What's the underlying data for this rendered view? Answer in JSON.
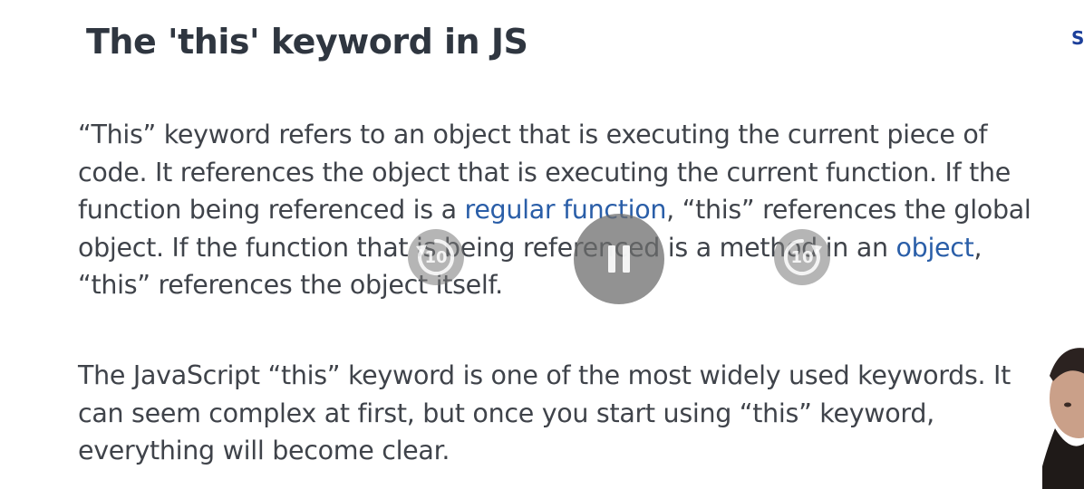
{
  "slide": {
    "title": "The 'this' keyword in JS",
    "corner_link": "S",
    "paragraph1": {
      "line1": "“This” keyword refers to an object that is executing the current piece of",
      "line2": "code. It references the object that is executing the current function. If the",
      "line3_before": "function being referenced is a ",
      "line3_link": "regular function",
      "line3_after": ", “this” references the global",
      "line4_before": "object. If the function that is being referenced is a method in an ",
      "line4_link": "object",
      "line4_after": ",",
      "line5": "“this” references the object itself."
    },
    "paragraph2": {
      "line1": "The JavaScript “this” keyword is one of the most widely used keywords. It",
      "line2": "can seem complex at first, but once you start using “this” keyword,",
      "line3": "everything will become clear."
    }
  },
  "player": {
    "rewind_seconds": "10",
    "forward_seconds": "10",
    "icons": {
      "rewind": "rewind-10-icon",
      "pause": "pause-icon",
      "forward": "forward-10-icon"
    }
  },
  "colors": {
    "title": "#2f3640",
    "text": "#3f434a",
    "link": "#2a5ea8",
    "corner_link": "#1c3f9a"
  }
}
